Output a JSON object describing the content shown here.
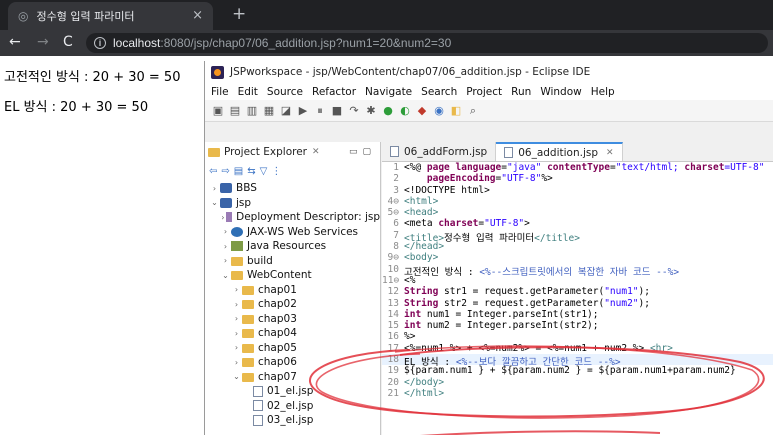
{
  "browser": {
    "tab_title": "정수형 입력 파라미터",
    "url_host": "localhost",
    "url_rest": ":8080/jsp/chap07/06_addition.jsp?num1=20&num2=30",
    "back_glyph": "←",
    "forward_glyph": "→",
    "reload_glyph": "C",
    "newtab_glyph": "+",
    "close_glyph": "×"
  },
  "page": {
    "line1": "고전적인 방식 : 20 + 30 = 50",
    "line2": "EL 방식 : 20 + 30 = 50"
  },
  "eclipse": {
    "title": "JSPworkspace - jsp/WebContent/chap07/06_addition.jsp - Eclipse IDE",
    "menu": [
      "File",
      "Edit",
      "Source",
      "Refactor",
      "Navigate",
      "Search",
      "Project",
      "Run",
      "Window",
      "Help"
    ],
    "project_explorer": {
      "title": "Project Explorer",
      "items": [
        {
          "label": "BBS"
        },
        {
          "label": "jsp"
        },
        {
          "label": "Deployment Descriptor: jsp"
        },
        {
          "label": "JAX-WS Web Services"
        },
        {
          "label": "Java Resources"
        },
        {
          "label": "build"
        },
        {
          "label": "WebContent"
        },
        {
          "label": "chap01"
        },
        {
          "label": "chap02"
        },
        {
          "label": "chap03"
        },
        {
          "label": "chap04"
        },
        {
          "label": "chap05"
        },
        {
          "label": "chap06"
        },
        {
          "label": "chap07"
        },
        {
          "label": "01_el.jsp"
        },
        {
          "label": "02_el.jsp"
        },
        {
          "label": "03_el.jsp"
        }
      ]
    },
    "editor": {
      "tabs": [
        "06_addForm.jsp",
        "06_addition.jsp"
      ],
      "lines": [
        {
          "n": "1",
          "text": "<%@ page language=\"java\" contentType=\"text/html; charset=UTF-8\""
        },
        {
          "n": "2",
          "text": "    pageEncoding=\"UTF-8\"%>"
        },
        {
          "n": "3",
          "text": "<!DOCTYPE html>"
        },
        {
          "n": "4⊖",
          "text": "<html>"
        },
        {
          "n": "5⊖",
          "text": "<head>"
        },
        {
          "n": "6",
          "text": "<meta charset=\"UTF-8\">"
        },
        {
          "n": "7",
          "text": "<title>정수형 입력 파라미터</title>"
        },
        {
          "n": "8",
          "text": "</head>"
        },
        {
          "n": "9⊖",
          "text": "<body>"
        },
        {
          "n": "10",
          "text": "고전적인 방식 : <%--스크립트릿에서의 복잡한 자바 코드 --%>"
        },
        {
          "n": "11⊖",
          "text": "<%"
        },
        {
          "n": "12",
          "text": "String str1 = request.getParameter(\"num1\");"
        },
        {
          "n": "13",
          "text": "String str2 = request.getParameter(\"num2\");"
        },
        {
          "n": "14",
          "text": "int num1 = Integer.parseInt(str1);"
        },
        {
          "n": "15",
          "text": "int num2 = Integer.parseInt(str2);"
        },
        {
          "n": "16",
          "text": "%>"
        },
        {
          "n": "17",
          "text": "<%=num1 %> + <%=num2%> = <%=num1 + num2 %> <hr>"
        },
        {
          "n": "18",
          "text": "EL 방식 : <%--보다 깔끔하고 간단한 코드 --%>"
        },
        {
          "n": "19",
          "text": "${param.num1 } + ${param.num2 } = ${param.num1+param.num2}"
        },
        {
          "n": "20",
          "text": "</body>"
        },
        {
          "n": "21",
          "text": "</html>"
        }
      ]
    }
  },
  "colors": {
    "chrome_dark": "#202124",
    "chrome_tab": "#35363a",
    "keyword": "#7f0055",
    "string": "#2a00ff",
    "tag": "#3f7f7f",
    "comment": "#3f5fbf",
    "annotation_red": "#e0303a"
  }
}
